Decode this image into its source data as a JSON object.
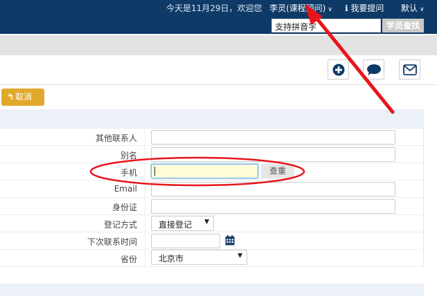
{
  "header": {
    "greeting": "今天是11月29日，欢迎您",
    "user": "李灵(课程顾问)",
    "help": "我要提问",
    "default": "默认",
    "search_value": "支持拼音字",
    "search_button": "学员查找"
  },
  "toolbar": {
    "cancel_label": "取消"
  },
  "form": {
    "fields": [
      {
        "label": "其他联系人",
        "value": ""
      },
      {
        "label": "别名",
        "value": ""
      },
      {
        "label": "手机",
        "value": ""
      },
      {
        "label": "Email",
        "value": ""
      },
      {
        "label": "身份证",
        "value": ""
      },
      {
        "label": "登记方式",
        "value": "直接登记"
      },
      {
        "label": "下次联系时间",
        "value": ""
      },
      {
        "label": "省份",
        "value": "北京市"
      }
    ],
    "check_button": "查重"
  },
  "colors": {
    "header_bg": "#0e3a67",
    "cancel_bg": "#e0a92c",
    "annotation": "#e8141a"
  },
  "icons": [
    "plus-circle-icon",
    "chat-bubble-icon",
    "envelope-icon",
    "reply-arrow-icon",
    "calendar-icon",
    "info-icon",
    "chevron-down-icon"
  ]
}
